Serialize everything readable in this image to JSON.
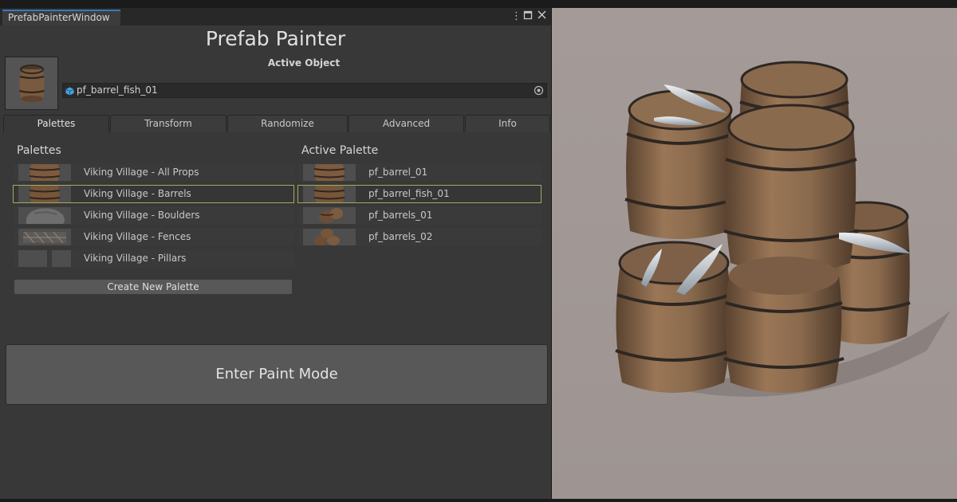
{
  "window": {
    "tab_label": "PrefabPainterWindow",
    "title": "Prefab Painter",
    "menu_icon": "kebab-menu-icon",
    "maximize_icon": "maximize-icon",
    "close_icon": "close-icon"
  },
  "active_object": {
    "label": "Active  Object",
    "value": "pf_barrel_fish_01"
  },
  "tabs": [
    {
      "label": "Palettes",
      "selected": true
    },
    {
      "label": "Transform",
      "selected": false
    },
    {
      "label": "Randomize",
      "selected": false
    },
    {
      "label": "Advanced",
      "selected": false
    },
    {
      "label": "Info",
      "selected": false
    }
  ],
  "palettes": {
    "title": "Palettes",
    "items": [
      {
        "label": "Viking Village - All Props",
        "selected": false
      },
      {
        "label": "Viking Village - Barrels",
        "selected": true
      },
      {
        "label": "Viking Village - Boulders",
        "selected": false
      },
      {
        "label": "Viking Village - Fences",
        "selected": false
      },
      {
        "label": "Viking Village - Pillars",
        "selected": false
      }
    ],
    "create_label": "Create New Palette"
  },
  "active_palette": {
    "title": "Active Palette",
    "items": [
      {
        "label": "pf_barrel_01",
        "selected": false
      },
      {
        "label": "pf_barrel_fish_01",
        "selected": true
      },
      {
        "label": "pf_barrels_01",
        "selected": false
      },
      {
        "label": "pf_barrels_02",
        "selected": false
      }
    ]
  },
  "paint_button": "Enter Paint Mode",
  "colors": {
    "accent_tab": "#3a79bb",
    "selection_outline": "#a8a860",
    "panel_bg": "#383838"
  }
}
